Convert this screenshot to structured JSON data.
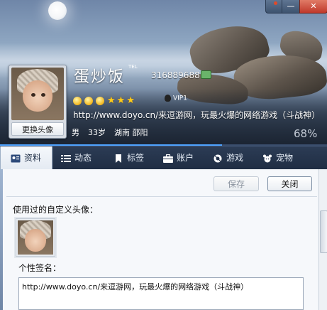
{
  "titlebar": {
    "skin": "●",
    "minimize": "—",
    "close": "✕"
  },
  "profile": {
    "nickname": "蛋炒饭",
    "tel_tag": "TEL",
    "qq_number": "316889688",
    "vip_label": "VIP1",
    "signature_display": "http://www.doyo.cn/来逗游网，玩最火爆的网络游戏（斗战神）",
    "gender": "男",
    "age": "33岁",
    "location": "湖南 邵阳",
    "completion": "68%",
    "completion_value": 0.68,
    "level_icons": [
      "sun-icon",
      "sun-icon",
      "sun-icon",
      "star-icon",
      "star-icon",
      "star-icon"
    ]
  },
  "avatar": {
    "change_label": "更换头像"
  },
  "tabs": [
    {
      "label": "资料",
      "icon": "profile-card-icon",
      "active": true
    },
    {
      "label": "动态",
      "icon": "list-icon",
      "active": false
    },
    {
      "label": "标签",
      "icon": "bookmark-icon",
      "active": false
    },
    {
      "label": "账户",
      "icon": "briefcase-icon",
      "active": false
    },
    {
      "label": "游戏",
      "icon": "game-icon",
      "active": false
    },
    {
      "label": "宠物",
      "icon": "pet-icon",
      "active": false
    }
  ],
  "toolbar": {
    "save_label": "保存",
    "close_label": "关闭"
  },
  "content": {
    "custom_avatar_label": "使用过的自定义头像：",
    "signature_label": "个性签名：",
    "signature_value": "http://www.doyo.cn/来逗游网，玩最火爆的网络游戏（斗战神）"
  },
  "colors": {
    "accent": "#4fa3ff",
    "tabbar": "#22314a",
    "close_button": "#c0392b"
  }
}
